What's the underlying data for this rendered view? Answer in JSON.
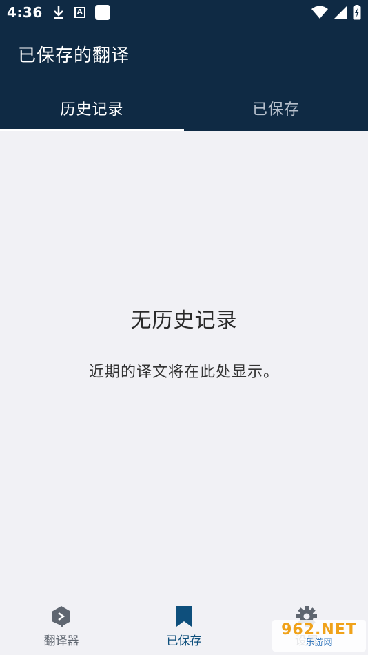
{
  "status_bar": {
    "time": "4:36"
  },
  "header": {
    "title": "已保存的翻译"
  },
  "tabs": [
    {
      "label": "历史记录",
      "active": true
    },
    {
      "label": "已保存",
      "active": false
    }
  ],
  "empty_state": {
    "title": "无历史记录",
    "subtitle": "近期的译文将在此处显示。"
  },
  "bottom_nav": [
    {
      "label": "翻译器",
      "icon": "deepl-logo-icon",
      "active": false
    },
    {
      "label": "已保存",
      "icon": "bookmark-icon",
      "active": true
    },
    {
      "label": "设置",
      "icon": "gear-icon",
      "active": false
    }
  ],
  "watermark": {
    "top": "962.NET",
    "bottom": "乐游网"
  },
  "colors": {
    "header_bg": "#0f2a44",
    "body_bg": "#f1f1f5",
    "active_nav": "#0e4f7c"
  }
}
